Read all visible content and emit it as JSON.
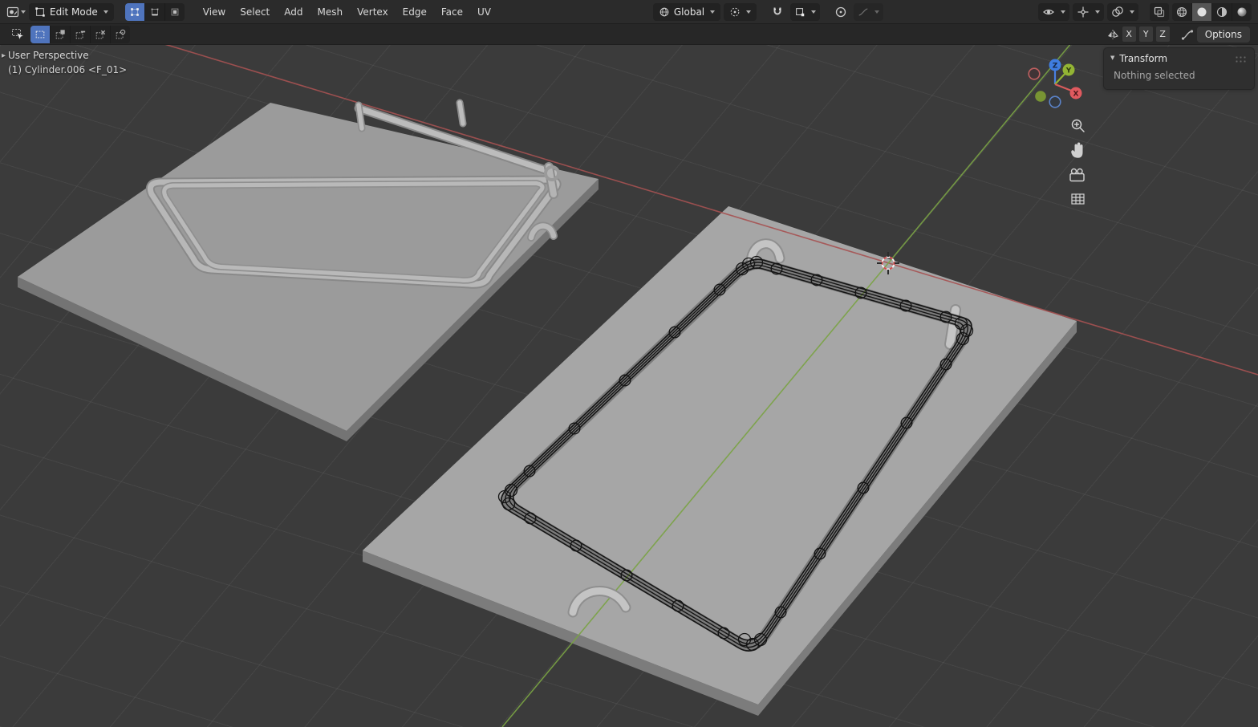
{
  "topbar": {
    "mode_label": "Edit Mode",
    "menus": [
      "View",
      "Select",
      "Add",
      "Mesh",
      "Vertex",
      "Edge",
      "Face",
      "UV"
    ],
    "orientation_label": "Global"
  },
  "tool_settings": {
    "axis_toggle_labels": [
      "X",
      "Y",
      "Z"
    ],
    "options_label": "Options"
  },
  "viewport": {
    "perspective_label": "User Perspective",
    "object_info": "(1) Cylinder.006 <F_01>",
    "gizmo": {
      "x": "X",
      "y": "Y",
      "z": "Z"
    }
  },
  "sidebar": {
    "panel_title": "Transform",
    "status_message": "Nothing selected"
  },
  "icons": {
    "editor-type-icon": "3d-viewport",
    "edit-mode-icon": "cube-edit",
    "vertex-select-icon": "vertices",
    "edge-select-icon": "edges",
    "face-select-icon": "faces",
    "orientation-globe-icon": "globe",
    "pivot-point-icon": "pivot-center",
    "snap-magnet-icon": "magnet",
    "snap-target-icon": "snap-to-increment",
    "proportional-edit-icon": "circle-dot",
    "falloff-curve-icon": "smooth-curve",
    "visibility-eye-icon": "eye",
    "gizmos-icon": "gizmo",
    "overlays-icon": "overlapping-circles",
    "xray-icon": "overlapping-squares",
    "shading-wireframe-icon": "wire-sphere",
    "shading-solid-icon": "solid-sphere",
    "shading-material-icon": "material-sphere",
    "shading-rendered-icon": "rendered-sphere",
    "box-select-tool-icon": "cursor-dashed-box",
    "select-mode-icons": "dashed-squares",
    "mirror-icon": "mirror-triangles",
    "zoom-icon": "magnifier-plus",
    "pan-hand-icon": "hand",
    "camera-view-icon": "movie-camera",
    "ortho-grid-icon": "grid",
    "3d-cursor-icon": "red-white-crosshair-circle"
  },
  "colors": {
    "accent_blue": "#4f74bd",
    "axis_x": "#e05a5f",
    "axis_y": "#93b434",
    "axis_z": "#3f7de0",
    "viewport_bg": "#3b3b3b",
    "header_bg": "#2b2b2b"
  }
}
